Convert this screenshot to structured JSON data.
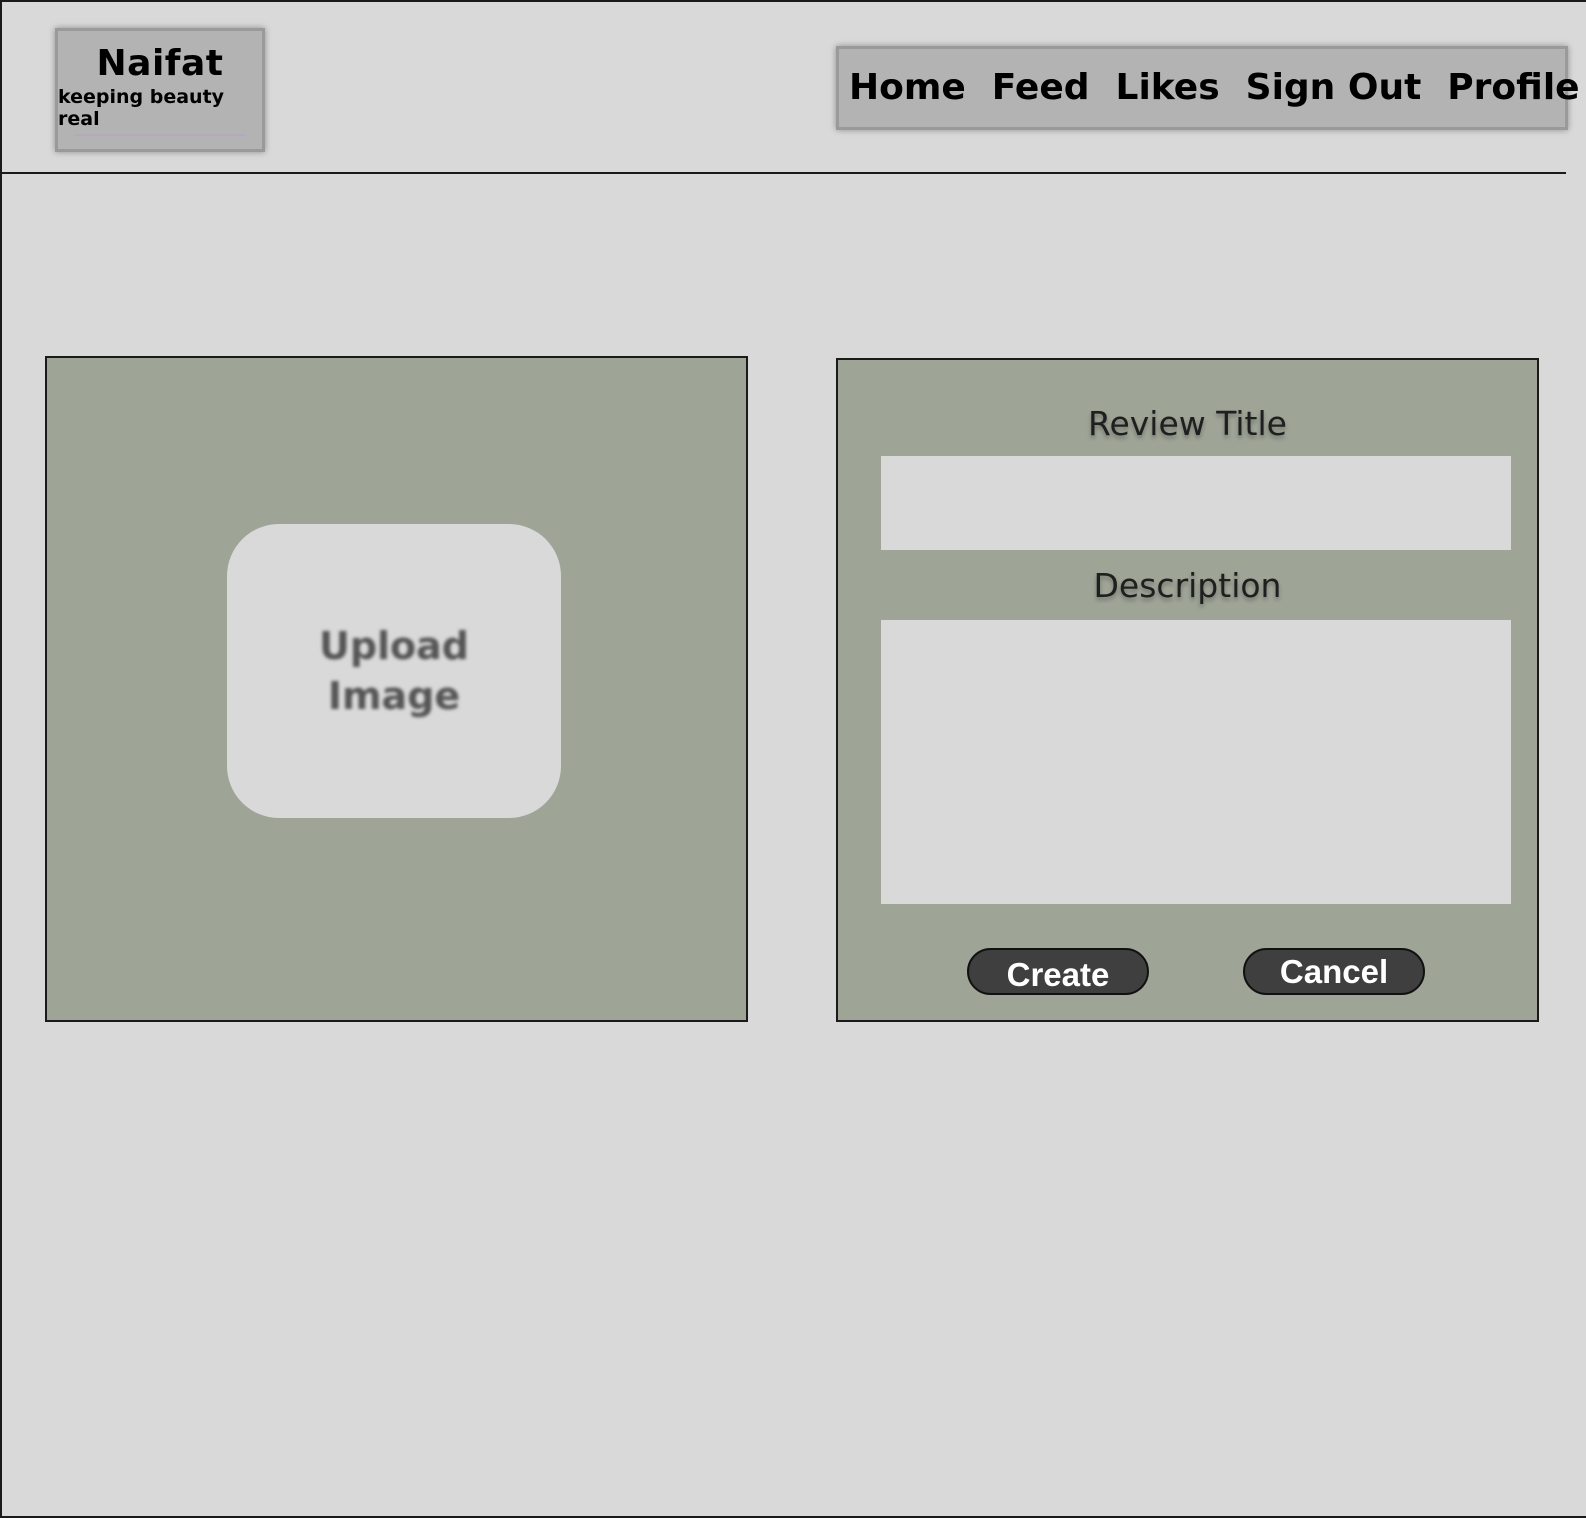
{
  "logo": {
    "name": "Naifat",
    "tagline": "keeping beauty real"
  },
  "nav": {
    "items": [
      {
        "label": "Home"
      },
      {
        "label": "Feed"
      },
      {
        "label": "Likes"
      },
      {
        "label": "Sign Out"
      },
      {
        "label": "Profile"
      }
    ]
  },
  "upload": {
    "label_line1": "Upload",
    "label_line2": "Image"
  },
  "form": {
    "title_label": "Review Title",
    "title_value": "",
    "description_label": "Description",
    "description_value": "",
    "create_label": "Create",
    "cancel_label": "Cancel"
  },
  "colors": {
    "page_background": "#d9d9d9",
    "header_box": "#b3b3b3",
    "panel": "#9ea597",
    "button": "#3f3f3f"
  }
}
